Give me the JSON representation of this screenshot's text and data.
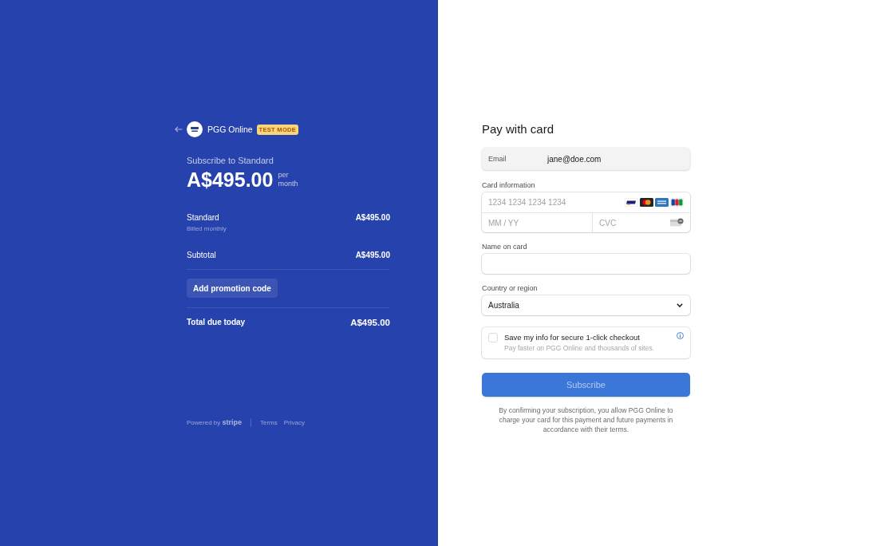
{
  "summary": {
    "merchant": {
      "name": "PGG Online",
      "badge": "TEST MODE"
    },
    "subscribe_title": "Subscribe to Standard",
    "price": "A$495.00",
    "period": "per month",
    "line_items": [
      {
        "name": "Standard",
        "description": "Billed monthly",
        "amount": "A$495.00"
      }
    ],
    "subtotal": {
      "label": "Subtotal",
      "amount": "A$495.00"
    },
    "promo_button": "Add promotion code",
    "total": {
      "label": "Total due today",
      "amount": "A$495.00"
    },
    "footer": {
      "powered_by": "Powered by **stripe**",
      "links": [
        "Terms",
        "Privacy"
      ]
    }
  },
  "payment": {
    "title": "Pay with card",
    "email": {
      "label": "Email",
      "value": "jane@doe.com"
    },
    "card": {
      "label": "Card information",
      "number_placeholder": "1234 1234 1234 1234",
      "expiry_placeholder": "MM / YY",
      "cvc_placeholder": "CVC"
    },
    "name_on_card": {
      "label": "Name on card"
    },
    "country": {
      "label": "Country or region",
      "value": "Australia"
    },
    "save_info": {
      "checked": false,
      "label": "Save my info for secure 1-click checkout",
      "description": "Pay faster on PGG Online and thousands of sites."
    },
    "submit": {
      "label": "Subscribe",
      "disabled": true
    },
    "terms": "By confirming your subscription, you allow PGG Online to charge your card for this payment and future payments in accordance with their terms."
  }
}
